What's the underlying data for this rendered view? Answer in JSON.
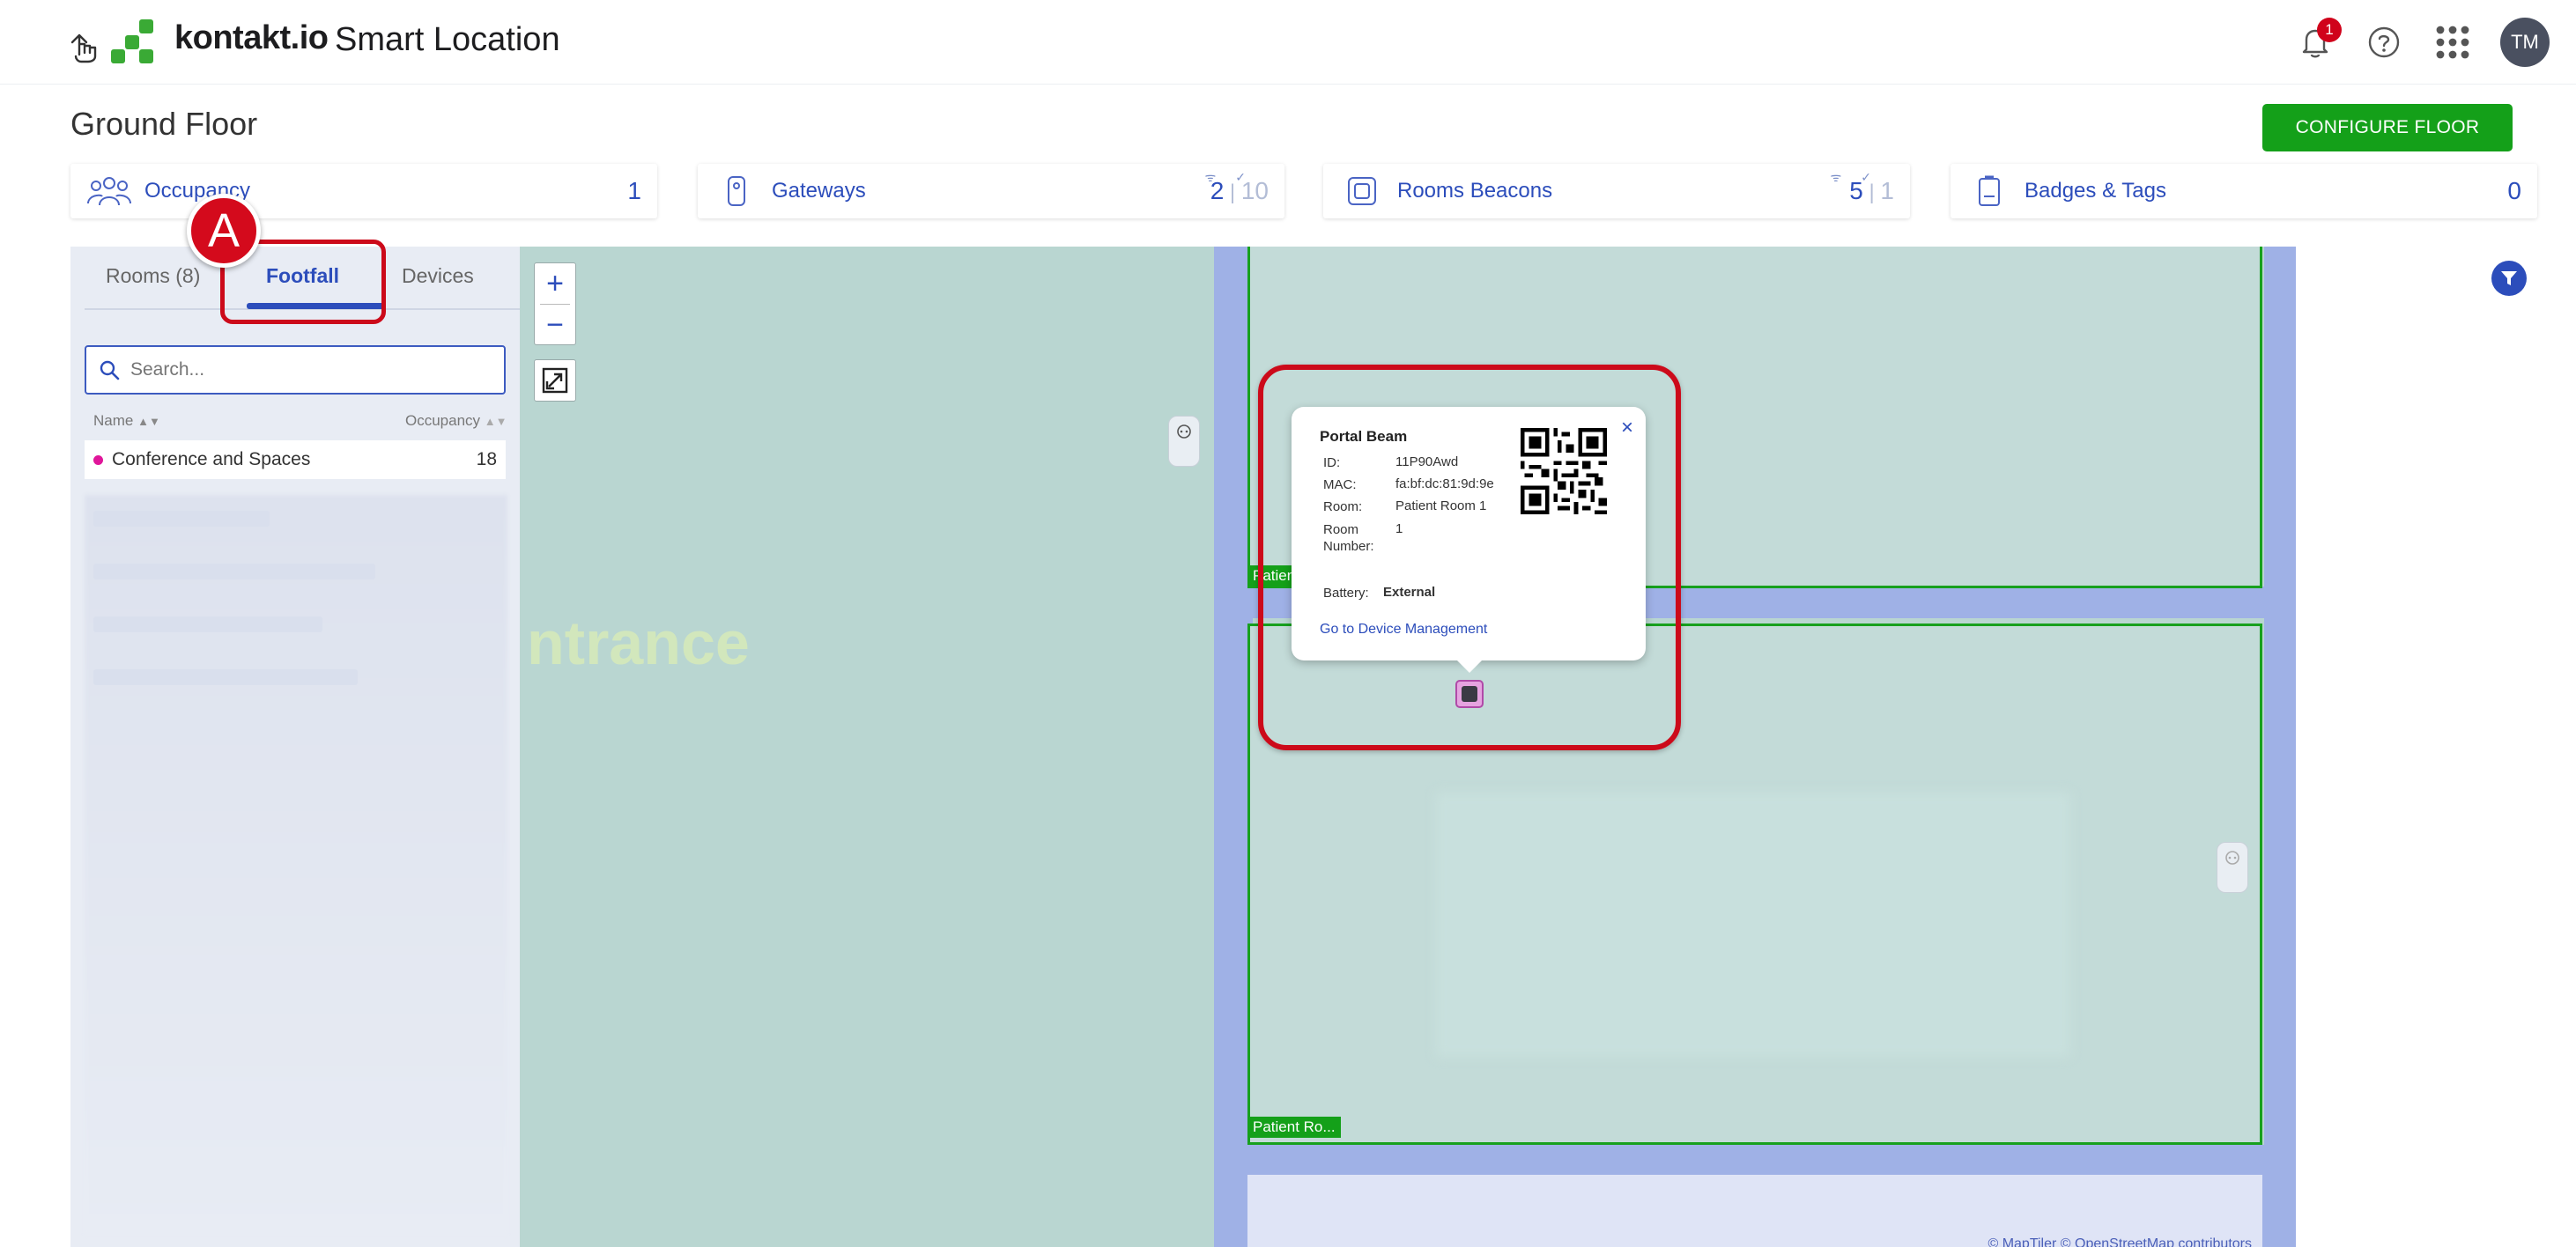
{
  "header": {
    "brand": "kontakt.io",
    "product": "Smart Location",
    "notification_count": "1",
    "avatar_initials": "TM"
  },
  "floor": {
    "title": "Ground Floor",
    "configure_button": "CONFIGURE FLOOR"
  },
  "stats": {
    "occupancy": {
      "label": "Occupancy",
      "value": "1"
    },
    "gateways": {
      "label": "Gateways",
      "online": "2",
      "offline": "10"
    },
    "rooms_beacons": {
      "label": "Rooms Beacons",
      "online": "5",
      "offline": "1"
    },
    "badges_tags": {
      "label": "Badges & Tags",
      "value": "0"
    }
  },
  "sidebar": {
    "tabs": [
      {
        "label": "Rooms (8)"
      },
      {
        "label": "Footfall",
        "active": true
      },
      {
        "label": "Devices"
      }
    ],
    "search_placeholder": "Search...",
    "columns": {
      "name": "Name",
      "occupancy": "Occupancy"
    },
    "rows": [
      {
        "name": "Conference and Spaces",
        "value": "18",
        "color": "#e0169a"
      }
    ]
  },
  "map": {
    "entrance_label": "ntrance",
    "room_labels": [
      "Patien",
      "Patient Ro..."
    ],
    "attribution": "© MapTiler © OpenStreetMap contributors"
  },
  "popup": {
    "title": "Portal Beam",
    "id_label": "ID:",
    "id_value": "11P90Awd",
    "mac_label": "MAC:",
    "mac_value": "fa:bf:dc:81:9d:9e",
    "room_label": "Room:",
    "room_value": "Patient Room 1",
    "room_number_label": "Room Number:",
    "room_number_value": "1",
    "battery_label": "Battery:",
    "battery_value": "External",
    "link": "Go to Device Management"
  },
  "annotation": {
    "marker": "A"
  },
  "colors": {
    "accent": "#2c4dbb",
    "primary_button": "#14a019",
    "highlight": "#cc0a1a"
  }
}
